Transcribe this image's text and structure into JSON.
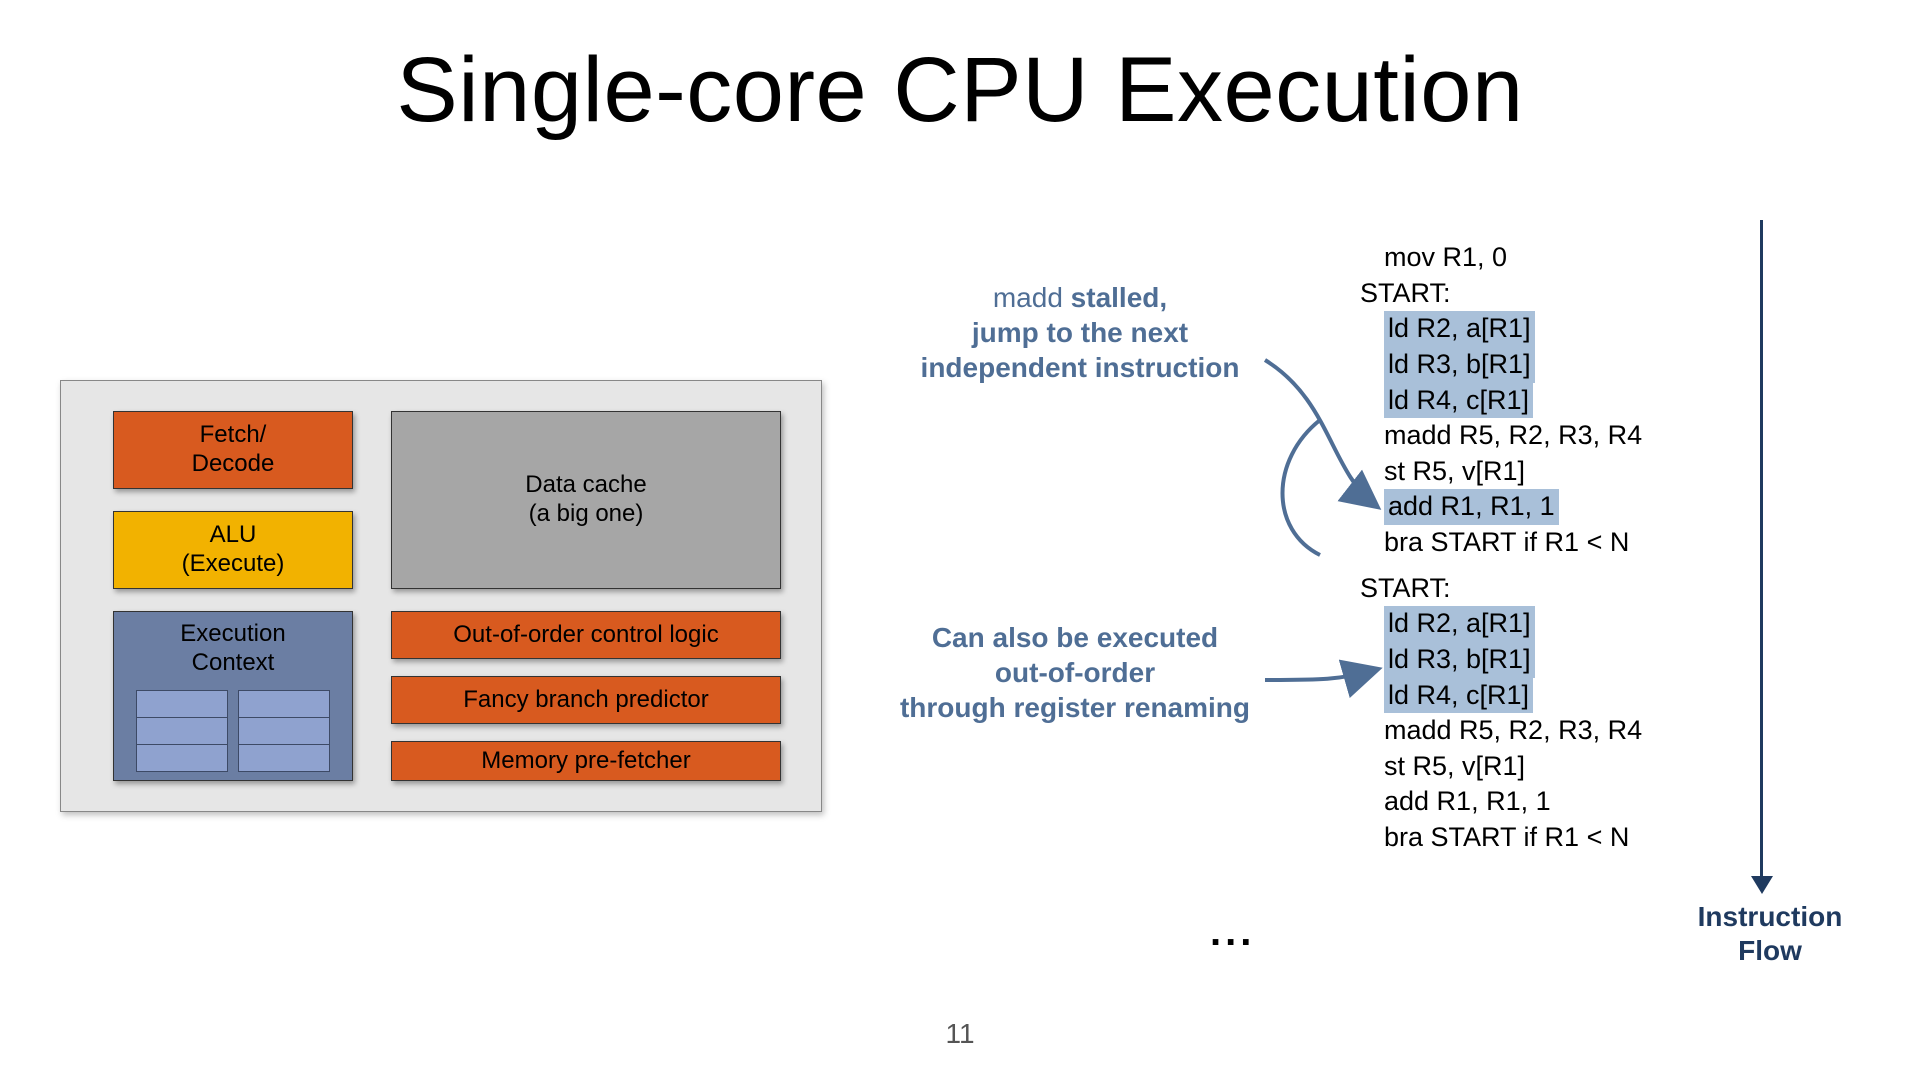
{
  "title": "Single-core CPU Execution",
  "page_number": "11",
  "cpu": {
    "fetch_decode": "Fetch/\nDecode",
    "alu": "ALU\n(Execute)",
    "context": "Execution\nContext",
    "cache": "Data cache\n(a big one)",
    "ooo": "Out-of-order control logic",
    "bp": "Fancy branch predictor",
    "prefetch": "Memory pre-fetcher"
  },
  "annotations": {
    "a1_line1": "madd ",
    "a1_bold": "stalled",
    "a1_rest": ",\njump to the next\nindependent instruction",
    "a2": "Can also be executed\nout-of-order\nthrough register renaming"
  },
  "code": {
    "l00": "mov R1, 0",
    "l01": "START:",
    "l02": "ld R2, a[R1]",
    "l03": "ld R3, b[R1]",
    "l04": "ld R4, c[R1]",
    "l05": "madd R5, R2, R3, R4",
    "l06": "st R5, v[R1]",
    "l07": "add R1, R1, 1",
    "l08": "bra START if R1 < N",
    "l09": "START:",
    "l10": "ld R2, a[R1]",
    "l11": "ld R3, b[R1]",
    "l12": "ld R4, c[R1]",
    "l13": "madd R5, R2, R3, R4",
    "l14": "st R5, v[R1]",
    "l15": "add R1, R1, 1",
    "l16": "bra START if R1 < N"
  },
  "ellipsis": "...",
  "iflow": "Instruction\nFlow"
}
